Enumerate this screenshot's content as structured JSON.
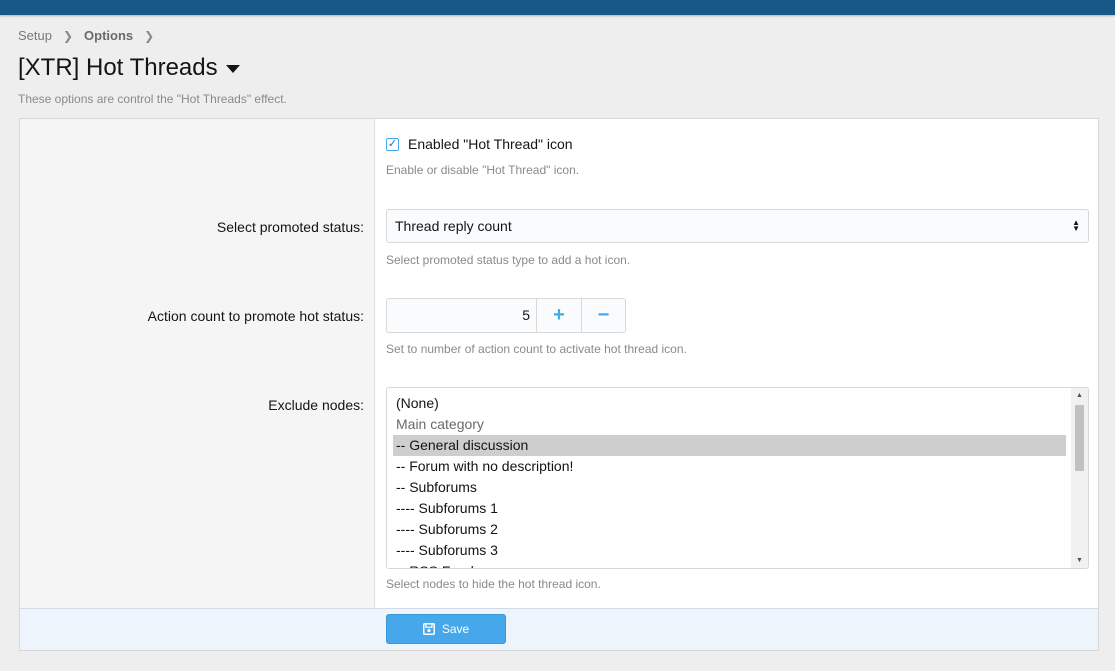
{
  "breadcrumb": {
    "items": [
      "Setup",
      "Options"
    ]
  },
  "page": {
    "title": "[XTR] Hot Threads",
    "description": "These options are control the \"Hot Threads\" effect."
  },
  "options": {
    "enabled": {
      "label": "Enabled \"Hot Thread\" icon",
      "checked": true,
      "hint": "Enable or disable \"Hot Thread\" icon."
    },
    "promoted_status": {
      "label": "Select promoted status:",
      "value": "Thread reply count",
      "hint": "Select promoted status type to add a hot icon."
    },
    "action_count": {
      "label": "Action count to promote hot status:",
      "value": "5",
      "plus": "+",
      "minus": "−",
      "hint": "Set to number of action count to activate hot thread icon."
    },
    "exclude_nodes": {
      "label": "Exclude nodes:",
      "items": [
        "(None)",
        "Main category",
        "-- General discussion",
        "-- Forum with no description!",
        "-- Subforums",
        "---- Subforums 1",
        "---- Subforums 2",
        "---- Subforums 3",
        "-- RSS Feeds"
      ],
      "selected": "-- General discussion",
      "hint": "Select nodes to hide the hot thread icon."
    }
  },
  "footer": {
    "save_label": "Save"
  },
  "colors": {
    "topbar": "#185886",
    "accent": "#47a7eb",
    "footer_bg": "#edf4fb"
  }
}
